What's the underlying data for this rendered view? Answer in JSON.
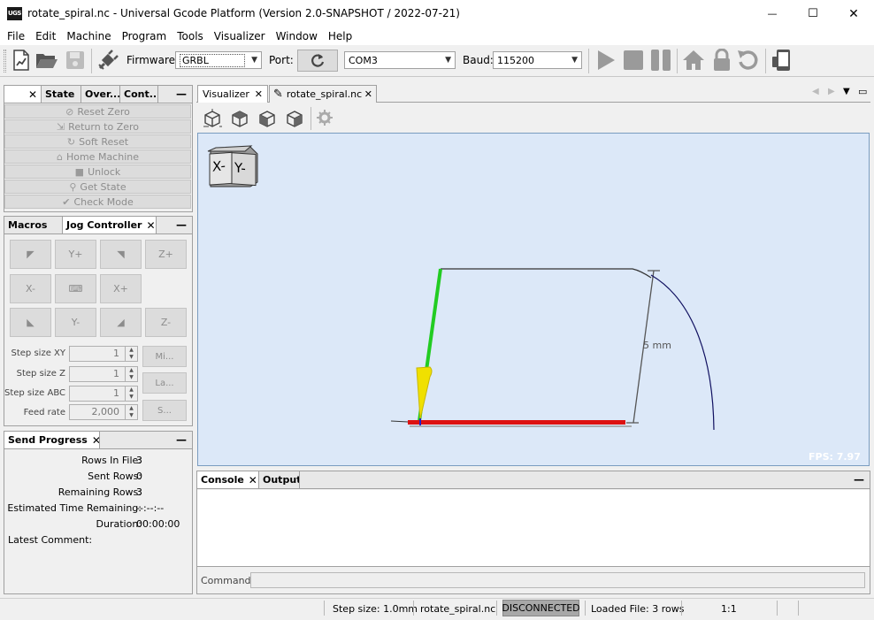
{
  "window": {
    "app_icon": "UGS",
    "title": "rotate_spiral.nc - Universal Gcode Platform (Version 2.0-SNAPSHOT / 2022-07-21)",
    "minimize": "—",
    "maximize": "☐",
    "close": "✕"
  },
  "menu": [
    "File",
    "Edit",
    "Machine",
    "Program",
    "Tools",
    "Visualizer",
    "Window",
    "Help"
  ],
  "toolbar": {
    "firmware_label": "Firmware:",
    "firmware_value": "GRBL",
    "port_label": "Port:",
    "port_value": "COM3",
    "baud_label": "Baud:",
    "baud_value": "115200"
  },
  "state_panel": {
    "tabs": [
      "",
      "State",
      "Over...",
      "Cont..."
    ],
    "buttons": [
      "Reset Zero",
      "Return to Zero",
      "Soft Reset",
      "Home Machine",
      "Unlock",
      "Get State",
      "Check Mode"
    ]
  },
  "jog_panel": {
    "tabs": [
      "Macros",
      "Jog Controller"
    ],
    "buttons": {
      "y_plus": "Y+",
      "z_plus": "Z+",
      "x_minus": "X-",
      "x_plus": "X+",
      "y_minus": "Y-",
      "z_minus": "Z-"
    },
    "step_xy_label": "Step size XY",
    "step_xy": "1",
    "step_z_label": "Step size Z",
    "step_z": "1",
    "step_abc_label": "Step size ABC",
    "step_abc": "1",
    "feed_label": "Feed rate",
    "feed": "2,000",
    "side_buttons": [
      "Mi...",
      "La...",
      "S..."
    ]
  },
  "progress_panel": {
    "title": "Send Progress",
    "rows_in_file_label": "Rows In File:",
    "rows_in_file": "3",
    "sent_rows_label": "Sent Rows:",
    "sent_rows": "0",
    "remaining_rows_label": "Remaining Rows:",
    "remaining_rows": "3",
    "est_time_label": "Estimated Time Remaining:",
    "est_time": "--:--:--",
    "duration_label": "Duration:",
    "duration": "00:00:00",
    "latest_comment_label": "Latest Comment:"
  },
  "editor_tabs": [
    "Visualizer",
    "rotate_spiral.nc"
  ],
  "visualizer": {
    "cube_x": "X-",
    "cube_y": "Y-",
    "dimension_label": "5 mm",
    "fps": "FPS: 7.97"
  },
  "console": {
    "tabs": [
      "Console",
      "Output"
    ],
    "command_label": "Command:"
  },
  "statusbar": {
    "step_size": "Step size: 1.0mm",
    "file": "rotate_spiral.nc",
    "connection": "DISCONNECTED",
    "loaded": "Loaded File: 3 rows",
    "zoom": "1:1"
  },
  "colors": {
    "visualizer_bg": "#dce8f8",
    "tool_path_green": "#22cc22",
    "tool_yellow": "#f0e000",
    "toolpath_red": "#dd1111",
    "arc_navy": "#101060"
  }
}
